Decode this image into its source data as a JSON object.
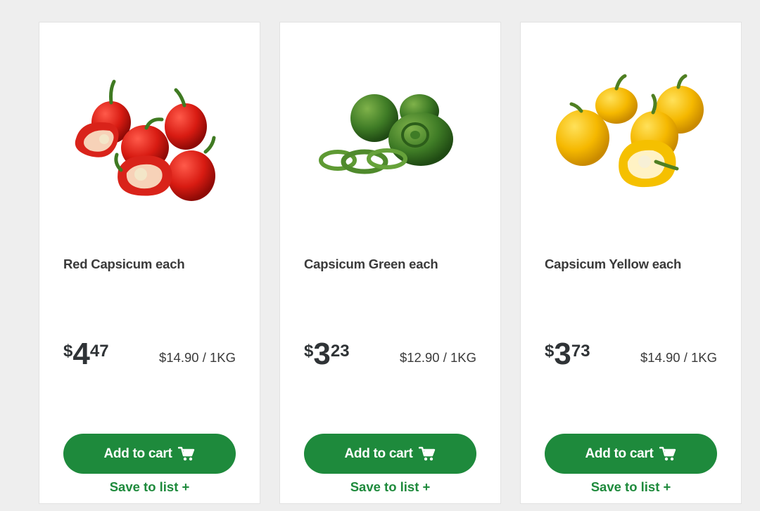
{
  "colors": {
    "accent": "#1e8a3c",
    "page_bg": "#eeeeee",
    "card_bg": "#ffffff"
  },
  "products": [
    {
      "name": "Red Capsicum each",
      "image_icon": "red-capsicum-image",
      "price": {
        "dollar_sign": "$",
        "dollars": "4",
        "cents": "47"
      },
      "unit_price": "$14.90 / 1KG",
      "add_to_cart_label": "Add to cart",
      "save_to_list_label": "Save to list +"
    },
    {
      "name": "Capsicum Green each",
      "image_icon": "green-capsicum-image",
      "price": {
        "dollar_sign": "$",
        "dollars": "3",
        "cents": "23"
      },
      "unit_price": "$12.90 / 1KG",
      "add_to_cart_label": "Add to cart",
      "save_to_list_label": "Save to list +"
    },
    {
      "name": "Capsicum Yellow each",
      "image_icon": "yellow-capsicum-image",
      "price": {
        "dollar_sign": "$",
        "dollars": "3",
        "cents": "73"
      },
      "unit_price": "$14.90 / 1KG",
      "add_to_cart_label": "Add to cart",
      "save_to_list_label": "Save to list +"
    }
  ]
}
